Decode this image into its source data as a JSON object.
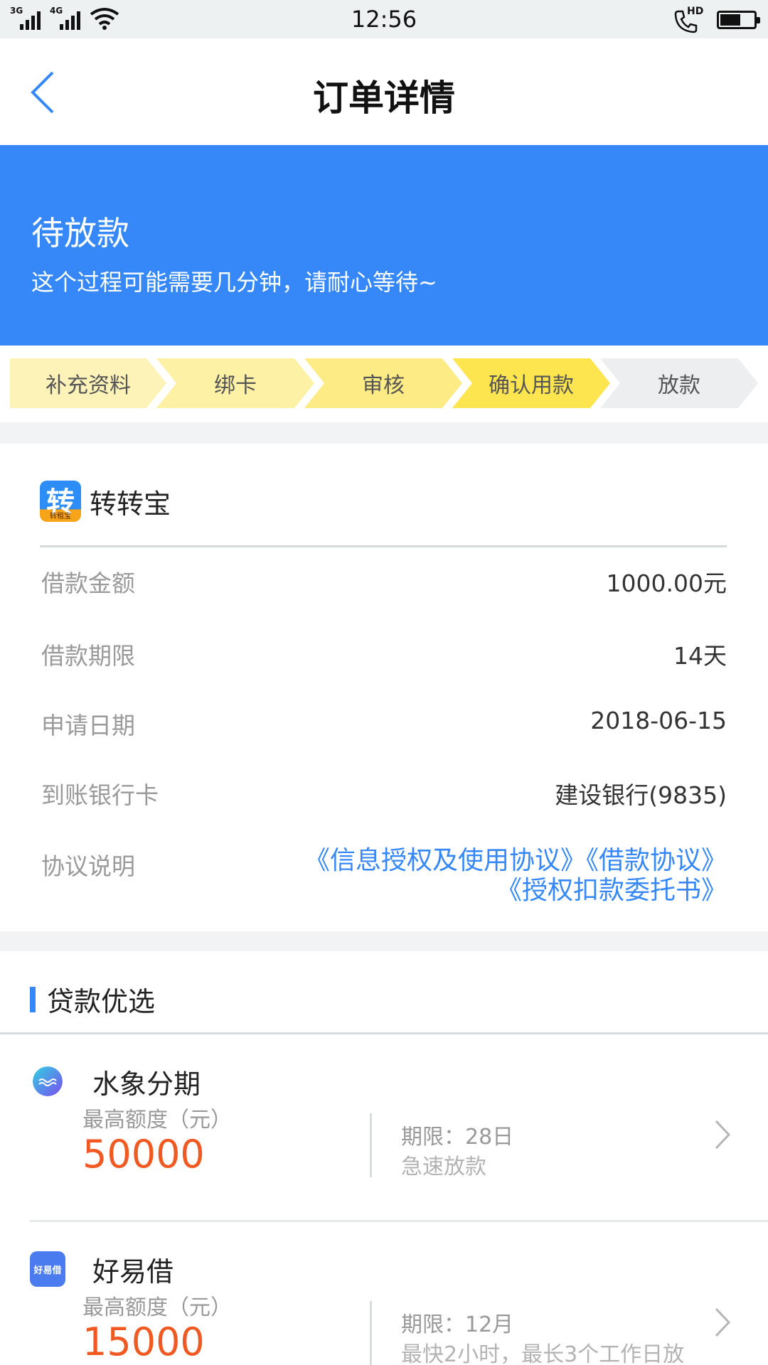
{
  "status_bar": {
    "time": "12:56",
    "sim1": "3G",
    "sim2": "4G",
    "call_badge": "HD",
    "battery_level": 0.55
  },
  "header": {
    "title": "订单详情",
    "back_icon": "chevron-left-icon"
  },
  "banner": {
    "status": "待放款",
    "hint": "这个过程可能需要几分钟，请耐心等待~",
    "color": "#3688f8"
  },
  "steps": [
    {
      "label": "补充资料",
      "color": "#fdf3b8"
    },
    {
      "label": "绑卡",
      "color": "#fdf1a6"
    },
    {
      "label": "审核",
      "color": "#fdec86"
    },
    {
      "label": "确认用款",
      "color": "#fde54f"
    },
    {
      "label": "放款",
      "color": "#eceeef"
    }
  ],
  "order": {
    "merchant_name": "转转宝",
    "merchant_logo_text": "转",
    "merchant_logo_subtext": "转租宝",
    "rows": [
      {
        "label": "借款金额",
        "value": "1000.00元"
      },
      {
        "label": "借款期限",
        "value": "14天"
      },
      {
        "label": "申请日期",
        "value": "2018-06-15"
      },
      {
        "label": "到账银行卡",
        "value": "建设银行(9835)"
      }
    ],
    "agreement_label": "协议说明",
    "agreements": [
      "《信息授权及使用协议》",
      "《借款协议》",
      "《授权扣款委托书》"
    ]
  },
  "recommend": {
    "title": "贷款优选",
    "loans": [
      {
        "name": "水象分期",
        "cap_label": "最高额度（元）",
        "amount": "50000",
        "term": "期限：28日",
        "desc": "急速放款",
        "logo_icon": "water-drop-icon"
      },
      {
        "name": "好易借",
        "cap_label": "最高额度（元）",
        "amount": "15000",
        "term": "期限：12月",
        "desc": "最快2小时，最长3个工作日放",
        "logo_icon": "haoyijie-logo-icon",
        "logo_text": "好易借"
      }
    ]
  }
}
